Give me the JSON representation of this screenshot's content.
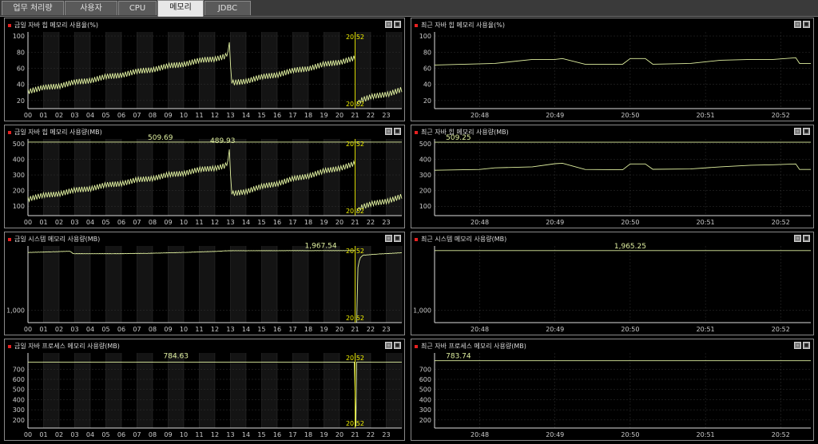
{
  "tabs": [
    {
      "label": "업무 처리량",
      "active": false
    },
    {
      "label": "사용자",
      "active": false
    },
    {
      "label": "CPU",
      "active": false
    },
    {
      "label": "메모리",
      "active": true
    },
    {
      "label": "JDBC",
      "active": false
    }
  ],
  "colors": {
    "line": "#e0f0a0",
    "marker": "#d8d800",
    "marker_text": "#f0f000",
    "grid": "#333333",
    "stripe": "#141414",
    "axis": "#cccccc"
  },
  "panels": {
    "p0": {
      "title": "금일 자바 힙 메모리 사용율(%)"
    },
    "p1": {
      "title": "최근 자바 힙 메모리 사용율(%)"
    },
    "p2": {
      "title": "금일 자바 힙 메모리 사용량(MB)"
    },
    "p3": {
      "title": "최근 자바 힙 메모리 사용량(MB)"
    },
    "p4": {
      "title": "금일 시스템 메모리 사용량(MB)"
    },
    "p5": {
      "title": "최근 시스템 메모리 사용량(MB)"
    },
    "p6": {
      "title": "금일 자바 프로세스 메모리 사용량(MB)"
    },
    "p7": {
      "title": "최근 자바 프로세스 메모리 사용량(MB)"
    }
  },
  "chart_data": [
    {
      "panel": "p0",
      "type": "line",
      "style": "today",
      "title": "금일 자바 힙 메모리 사용율(%)",
      "ylim": [
        10,
        105
      ],
      "yticks": [
        20,
        40,
        60,
        80,
        100
      ],
      "ytick_labels": [
        "20",
        "40",
        "60",
        "80",
        "100"
      ],
      "xlim": [
        0,
        24
      ],
      "xticks": [
        "00",
        "01",
        "02",
        "03",
        "04",
        "05",
        "06",
        "07",
        "08",
        "09",
        "10",
        "11",
        "12",
        "13",
        "14",
        "15",
        "16",
        "17",
        "18",
        "19",
        "20",
        "21",
        "22",
        "23"
      ],
      "marker": {
        "x": 21,
        "label_top": "20:52",
        "label_bottom": "20:52"
      },
      "series": [
        {
          "x": [
            0,
            12.8,
            12.95,
            13.05,
            21
          ],
          "y": [
            32,
            75,
            95,
            41,
            72
          ],
          "jitter": 4
        },
        {
          "x": [
            21.1,
            21.2,
            24
          ],
          "y": [
            12,
            20,
            33
          ],
          "jitter": 4
        }
      ]
    },
    {
      "panel": "p1",
      "type": "line",
      "style": "recent",
      "title": "최근 자바 힙 메모리 사용율(%)",
      "ylim": [
        10,
        105
      ],
      "yticks": [
        20,
        40,
        60,
        80,
        100
      ],
      "ytick_labels": [
        "20",
        "40",
        "60",
        "80",
        "100"
      ],
      "xlim": [
        0,
        5
      ],
      "xtick_positions": [
        0.6,
        1.6,
        2.6,
        3.6,
        4.6
      ],
      "xticks": [
        "20:48",
        "20:49",
        "20:50",
        "20:51",
        "20:52"
      ],
      "series": [
        {
          "x": [
            0,
            0.8,
            1.3,
            1.6,
            1.7,
            2.0,
            2.5,
            2.6,
            2.8,
            2.9,
            3.4,
            3.8,
            4.2,
            4.5,
            4.8,
            4.85,
            5
          ],
          "y": [
            64,
            66,
            71,
            71,
            72,
            65,
            65,
            72,
            72,
            65,
            66,
            70,
            71,
            71,
            73,
            66,
            66
          ],
          "jitter": 0
        }
      ]
    },
    {
      "panel": "p2",
      "type": "line",
      "style": "today",
      "title": "금일 자바 힙 메모리 사용량(MB)",
      "ylim": [
        40,
        530
      ],
      "yticks": [
        100,
        200,
        300,
        400,
        500
      ],
      "ytick_labels": [
        "100",
        "200",
        "300",
        "400",
        "500"
      ],
      "xlim": [
        0,
        24
      ],
      "xticks": [
        "00",
        "01",
        "02",
        "03",
        "04",
        "05",
        "06",
        "07",
        "08",
        "09",
        "10",
        "11",
        "12",
        "13",
        "14",
        "15",
        "16",
        "17",
        "18",
        "19",
        "20",
        "21",
        "22",
        "23"
      ],
      "marker": {
        "x": 21,
        "label_top": "20:52",
        "label_bottom": "20:52"
      },
      "ref_line": {
        "y": 509.69,
        "x_from": 0,
        "x_to": 21.2
      },
      "ref_line2": {
        "y": 509.69,
        "x_from": 21.2,
        "x_to": 24
      },
      "labels": [
        {
          "x": 8.5,
          "y": 509.69,
          "text": "509.69"
        },
        {
          "x": 12.5,
          "y": 489.93,
          "text": "489.93"
        }
      ],
      "series": [
        {
          "x": [
            0,
            12.8,
            12.95,
            13.05,
            21
          ],
          "y": [
            150,
            360,
            480,
            175,
            370
          ],
          "jitter": 20
        },
        {
          "x": [
            21.1,
            21.2,
            24
          ],
          "y": [
            50,
            90,
            160
          ],
          "jitter": 20
        }
      ]
    },
    {
      "panel": "p3",
      "type": "line",
      "style": "recent",
      "title": "최근 자바 힙 메모리 사용량(MB)",
      "ylim": [
        40,
        530
      ],
      "yticks": [
        100,
        200,
        300,
        400,
        500
      ],
      "ytick_labels": [
        "100",
        "200",
        "300",
        "400",
        "500"
      ],
      "xlim": [
        0,
        5
      ],
      "xtick_positions": [
        0.6,
        1.6,
        2.6,
        3.6,
        4.6
      ],
      "xticks": [
        "20:48",
        "20:49",
        "20:50",
        "20:51",
        "20:52"
      ],
      "ref_line": {
        "y": 509.25,
        "x_from": 0,
        "x_to": 5
      },
      "labels": [
        {
          "x": 0.15,
          "y": 509.25,
          "text": "509.25"
        }
      ],
      "series": [
        {
          "x": [
            0,
            0.6,
            0.8,
            1.3,
            1.6,
            1.7,
            2.0,
            2.5,
            2.6,
            2.8,
            2.9,
            3.4,
            3.8,
            4.2,
            4.5,
            4.8,
            4.85,
            5
          ],
          "y": [
            330,
            335,
            345,
            352,
            372,
            375,
            335,
            333,
            370,
            370,
            336,
            338,
            352,
            362,
            365,
            370,
            335,
            335
          ],
          "jitter": 0
        }
      ]
    },
    {
      "panel": "p4",
      "type": "line",
      "style": "today",
      "title": "금일 시스템 메모리 사용량(MB)",
      "ylim": [
        800,
        2040
      ],
      "yticks": [
        1000
      ],
      "ytick_labels": [
        "1,000"
      ],
      "xlim": [
        0,
        24
      ],
      "xticks": [
        "00",
        "01",
        "02",
        "03",
        "04",
        "05",
        "06",
        "07",
        "08",
        "09",
        "10",
        "11",
        "12",
        "13",
        "14",
        "15",
        "16",
        "17",
        "18",
        "19",
        "20",
        "21",
        "22",
        "23"
      ],
      "marker": {
        "x": 21,
        "label_top": "20:52",
        "label_bottom": "20:52"
      },
      "labels": [
        {
          "x": 18.8,
          "y": 1967.54,
          "text": "1,967.54"
        }
      ],
      "series": [
        {
          "x": [
            0,
            1.5,
            2.7,
            2.9,
            5.5,
            7.5,
            10,
            12.3,
            12.6,
            13,
            21
          ],
          "y": [
            1935,
            1945,
            1955,
            1915,
            1915,
            1920,
            1935,
            1955,
            1960,
            1963,
            1965
          ],
          "jitter": 2
        },
        {
          "x": [
            21.1,
            21.15,
            21.3,
            21.5,
            22.5,
            24
          ],
          "y": [
            805,
            1650,
            1840,
            1890,
            1910,
            1930
          ],
          "jitter": 2
        }
      ]
    },
    {
      "panel": "p5",
      "type": "line",
      "style": "recent",
      "title": "최근 시스템 메모리 사용량(MB)",
      "ylim": [
        800,
        2040
      ],
      "yticks": [
        1000
      ],
      "ytick_labels": [
        "1,000"
      ],
      "xlim": [
        0,
        5
      ],
      "xtick_positions": [
        0.6,
        1.6,
        2.6,
        3.6,
        4.6
      ],
      "xticks": [
        "20:48",
        "20:49",
        "20:50",
        "20:51",
        "20:52"
      ],
      "ref_line": {
        "y": 1965.25,
        "x_from": 0,
        "x_to": 5
      },
      "labels": [
        {
          "x": 2.6,
          "y": 1965.25,
          "text": "1,965.25"
        }
      ],
      "series": []
    },
    {
      "panel": "p6",
      "type": "line",
      "style": "today",
      "title": "금일 자바 프로세스 메모리 사용량(MB)",
      "ylim": [
        120,
        860
      ],
      "yticks": [
        200,
        300,
        400,
        500,
        600,
        700
      ],
      "ytick_labels": [
        "200",
        "300",
        "400",
        "500",
        "600",
        "700"
      ],
      "xlim": [
        0,
        24
      ],
      "xticks": [
        "00",
        "01",
        "02",
        "03",
        "04",
        "05",
        "06",
        "07",
        "08",
        "09",
        "10",
        "11",
        "12",
        "13",
        "14",
        "15",
        "16",
        "17",
        "18",
        "19",
        "20",
        "21",
        "22",
        "23"
      ],
      "marker": {
        "x": 21,
        "label_top": "20:52",
        "label_bottom": "20:52"
      },
      "labels": [
        {
          "x": 9.5,
          "y": 784.63,
          "text": "784.63"
        }
      ],
      "series": [
        {
          "x": [
            0,
            20.95,
            21.05,
            21.1,
            24
          ],
          "y": [
            770,
            770,
            135,
            770,
            770
          ],
          "jitter": 0
        }
      ]
    },
    {
      "panel": "p7",
      "type": "line",
      "style": "recent",
      "title": "최근 자바 프로세스 메모리 사용량(MB)",
      "ylim": [
        120,
        860
      ],
      "yticks": [
        200,
        300,
        400,
        500,
        600,
        700
      ],
      "ytick_labels": [
        "200",
        "300",
        "400",
        "500",
        "600",
        "700"
      ],
      "xlim": [
        0,
        5
      ],
      "xtick_positions": [
        0.6,
        1.6,
        2.6,
        3.6,
        4.6
      ],
      "xticks": [
        "20:48",
        "20:49",
        "20:50",
        "20:51",
        "20:52"
      ],
      "ref_line": {
        "y": 783.74,
        "x_from": 0,
        "x_to": 5
      },
      "labels": [
        {
          "x": 0.15,
          "y": 783.74,
          "text": "783.74"
        }
      ],
      "series": []
    }
  ]
}
